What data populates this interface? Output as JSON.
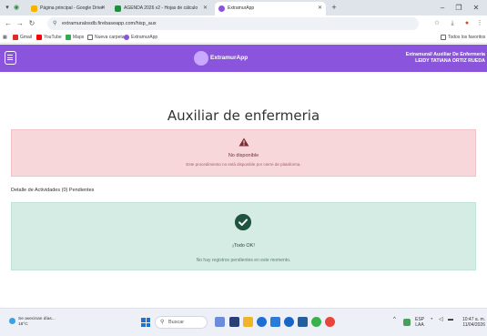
{
  "browser": {
    "tabs": [
      {
        "label": "Página principal - Google Drive",
        "active": false
      },
      {
        "label": "AGENDA 2026 v2 - Hojas de cálculo",
        "active": false
      },
      {
        "label": "ExtramurApp",
        "active": true
      }
    ],
    "new_tab": "+",
    "url": "extramuralosdb.firebaseapp.com/hisp_aux",
    "bookmarks": [
      "Gmail",
      "YouTube",
      "Maps",
      "Nueva carpeta",
      "ExtramurApp"
    ],
    "all_bookmarks": "Todos los favoritos"
  },
  "app": {
    "brand": "ExtramurApp",
    "user_role": "Extramural/ Auxiliar De Enfermeria",
    "user_name": "LEIDY TATIANA ORTIZ RUEDA"
  },
  "page": {
    "title": "Auxiliar de enfermeria",
    "alert_unavailable": {
      "title": "No disponible",
      "description": "Este procedimiento no está disponible por cierre de plataforma."
    },
    "section_label": "Detalle de Actividades (0) Pendientes",
    "alert_ok": {
      "title": "¡Todo OK!",
      "description": "No hay registros pendientes en este momento."
    }
  },
  "taskbar": {
    "weather_line1": "Se avecinan días...",
    "weather_line2": "18°C",
    "search_placeholder": "Buscar",
    "lang_line1": "ESP",
    "lang_line2": "LAA",
    "time": "10:47 a. m.",
    "date": "11/04/2026"
  },
  "colors": {
    "header": "#8a54dc",
    "danger_bg": "#f7d7da",
    "success_bg": "#d5ece4",
    "success_icon": "#1f5440"
  }
}
